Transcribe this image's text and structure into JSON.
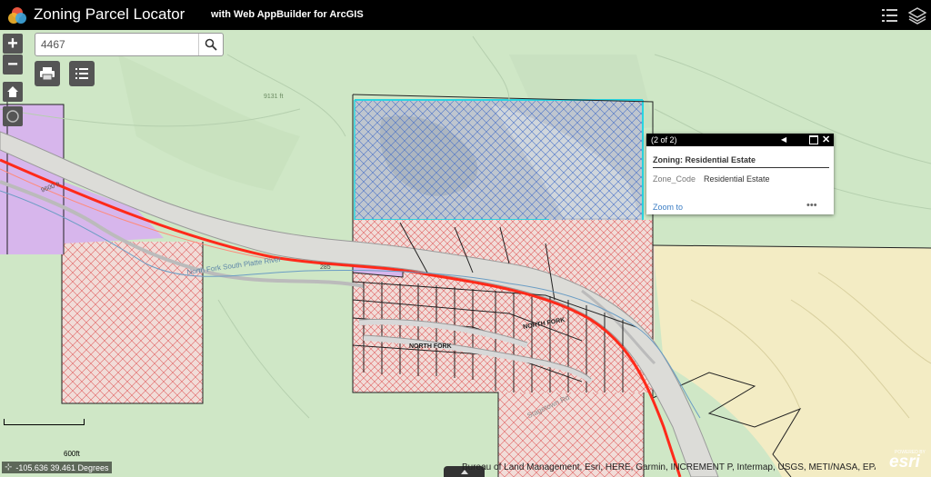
{
  "header": {
    "title": "Zoning Parcel Locator",
    "subtitle": "with Web AppBuilder for ArcGIS",
    "icons": [
      "logo-icon",
      "legend-list-icon",
      "layers-icon"
    ]
  },
  "search": {
    "value": "4467",
    "icon": "search-icon"
  },
  "toolbar": {
    "icons": [
      "print-icon",
      "layer-list-icon",
      "home-icon",
      "my-location-icon"
    ]
  },
  "popup": {
    "count": "(2 of 2)",
    "title": "Zoning: Residential Estate",
    "field": "Zone_Code",
    "value": "Residential Estate",
    "zoom_label": "Zoom to",
    "more_label": "•••"
  },
  "map_labels": {
    "river": "North Fork South Platte River",
    "road_north_fork_1": "NORTH FORK",
    "road_north_fork_2": "NORTH FORK",
    "road_stagetown": "Stagetown Rd",
    "contour_a": "9600 ft",
    "contour_b": "9131 ft",
    "road_number": "285"
  },
  "scale": {
    "label": "600ft"
  },
  "coordinates": {
    "text": "-105.636 39.461 Degrees"
  },
  "attribution": {
    "text": "Bureau of Land Management, Esri, HERE, Garmin, INCREMENT P, Intermap, USGS, METI/NASA, EPA,..."
  },
  "esri_logo": {
    "powered": "POWERED BY",
    "brand": "esri"
  },
  "colors": {
    "header": "#000000",
    "basemap_green": "#cfe7c6",
    "residential_estate_fill": "#bfc6cf",
    "selection_cyan": "#29d5e0",
    "hatch_red": "#e06060",
    "hatch_blue": "#4a72c8",
    "commercial_purple": "#d7b6ec",
    "tan_zone": "#f3ecc4",
    "highway_red": "#ff2a1a",
    "popup_link": "#3b7dc4"
  }
}
